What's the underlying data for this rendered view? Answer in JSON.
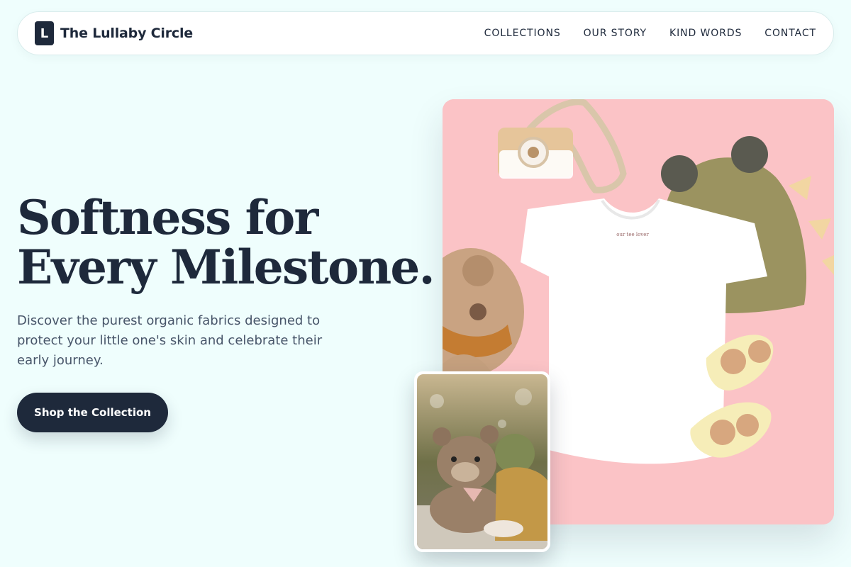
{
  "brand": {
    "logo_letter": "L",
    "name": "The Lullaby Circle"
  },
  "nav": {
    "links": [
      {
        "label": "COLLECTIONS"
      },
      {
        "label": "OUR STORY"
      },
      {
        "label": "KIND WORDS"
      },
      {
        "label": "CONTACT"
      }
    ]
  },
  "hero": {
    "title_line1": "Softness for",
    "title_line2": "Every Milestone.",
    "subtitle": "Discover the purest organic fabrics designed to protect your little one's skin and celebrate their early journey.",
    "cta_label": "Shop the Collection"
  },
  "images": {
    "main": {
      "tee_tag": "our tee lover"
    },
    "inset": {}
  },
  "colors": {
    "background": "#effefd",
    "primary": "#1e293b",
    "text_muted": "#475569",
    "photo_background": "#fbc3c6"
  }
}
